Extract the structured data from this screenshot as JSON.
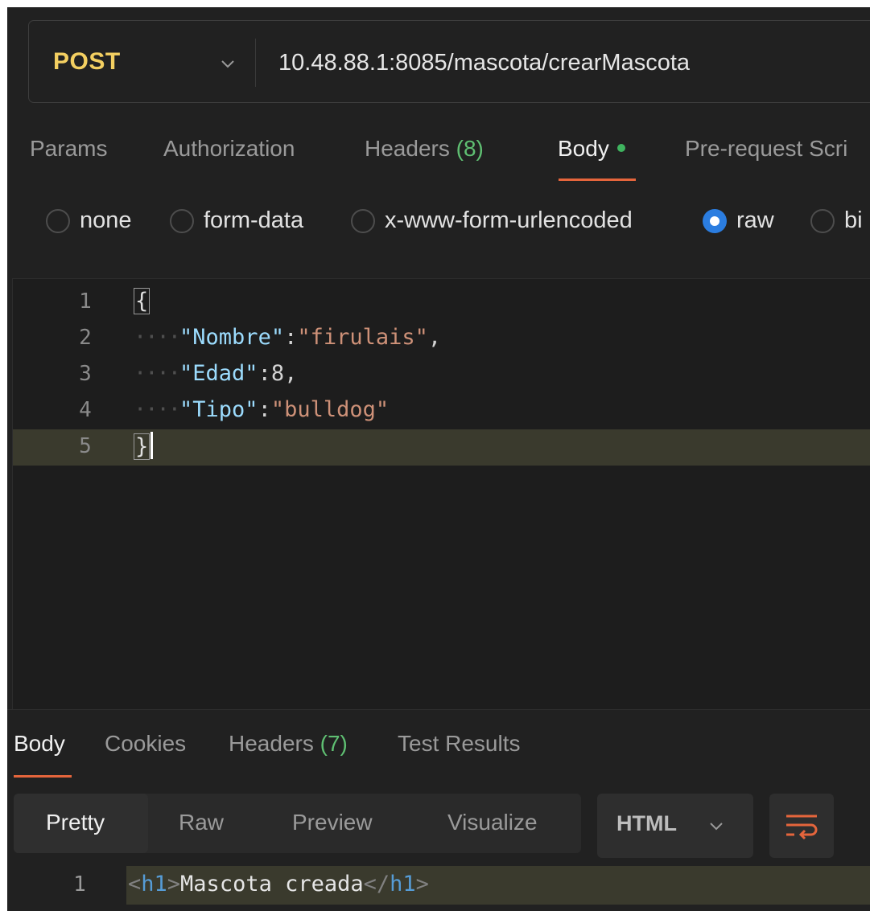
{
  "request": {
    "method": "POST",
    "url": "10.48.88.1:8085/mascota/crearMascota"
  },
  "request_tabs": {
    "params": "Params",
    "authorization": "Authorization",
    "headers_label": "Headers",
    "headers_count": "(8)",
    "body": "Body",
    "prerequest": "Pre-request Scri"
  },
  "body_types": {
    "none": "none",
    "form_data": "form-data",
    "urlencoded": "x-www-form-urlencoded",
    "raw": "raw",
    "binary": "bi",
    "selected": "raw"
  },
  "editor": {
    "lines": [
      {
        "no": "1",
        "open": "{"
      },
      {
        "no": "2",
        "key": "\"Nombre\"",
        "sep": ":",
        "value": "\"firulais\"",
        "tail": ","
      },
      {
        "no": "3",
        "key": "\"Edad\"",
        "sep": ":",
        "value": "8",
        "tail": ","
      },
      {
        "no": "4",
        "key": "\"Tipo\"",
        "sep": ":",
        "value": "\"bulldog\"",
        "tail": ""
      },
      {
        "no": "5",
        "close": "}"
      }
    ],
    "indent_marker": "····"
  },
  "response_tabs": {
    "body": "Body",
    "cookies": "Cookies",
    "headers_label": "Headers",
    "headers_count": "(7)",
    "test_results": "Test Results"
  },
  "response_view": {
    "pretty": "Pretty",
    "raw": "Raw",
    "preview": "Preview",
    "visualize": "Visualize",
    "format": "HTML"
  },
  "response_body": {
    "line_no": "1",
    "open_lt": "<",
    "open_tag": "h1",
    "open_gt": ">",
    "text": "Mascota creada",
    "close_lt": "</",
    "close_tag": "h1",
    "close_gt": ">"
  },
  "colors": {
    "method": "#f3cf61",
    "accent_underline": "#e5653c",
    "count_green": "#5fbf72",
    "radio_selected": "#2b7de0"
  }
}
